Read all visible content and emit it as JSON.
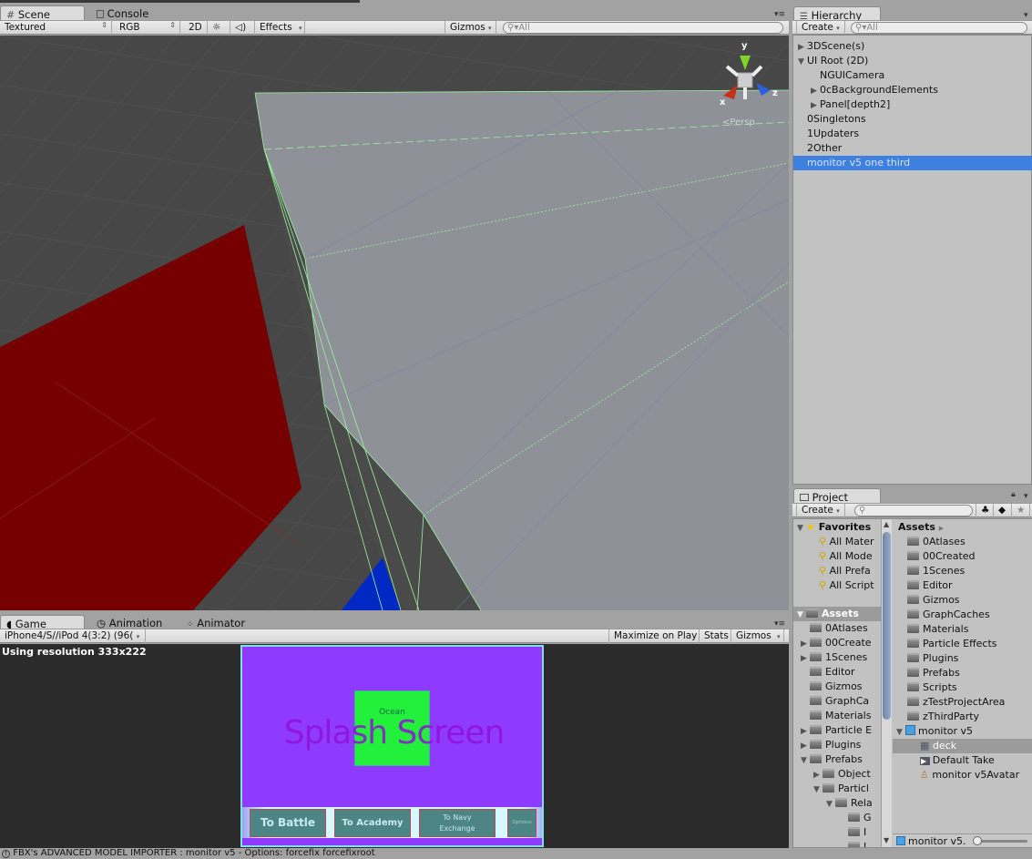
{
  "scene_panel": {
    "tabs": [
      {
        "label": "Scene",
        "icon": "grid-icon",
        "active": true
      },
      {
        "label": "Console",
        "icon": "console-icon",
        "active": false
      }
    ],
    "toolbar": {
      "shading_mode": "Textured",
      "render_mode": "RGB",
      "mode_2d": "2D",
      "lighting_icon": "sun-icon",
      "audio_icon": "speaker-icon",
      "effects": "Effects",
      "gizmos": "Gizmos",
      "search_placeholder": "All"
    },
    "orientation_gizmo": {
      "y": "y",
      "x": "x",
      "z": "z",
      "projection": "Persp"
    },
    "colors": {
      "background": "#474747",
      "plane": "#8e9198",
      "red_object": "#760000",
      "blue_object": "#0029c3",
      "wireframe": "#9cf59c"
    }
  },
  "hierarchy_panel": {
    "tab_label": "Hierarchy",
    "create_label": "Create",
    "search_placeholder": "All",
    "items": [
      {
        "label": "3DScene(s)",
        "depth": 0,
        "expander": "collapsed",
        "selected": false
      },
      {
        "label": "UI Root (2D)",
        "depth": 0,
        "expander": "expanded",
        "selected": false
      },
      {
        "label": "NGUICamera",
        "depth": 1,
        "expander": "none",
        "selected": false
      },
      {
        "label": "0cBackgroundElements",
        "depth": 1,
        "expander": "collapsed",
        "selected": false
      },
      {
        "label": "Panel[depth2]",
        "depth": 1,
        "expander": "collapsed",
        "selected": false
      },
      {
        "label": "0Singletons",
        "depth": 0,
        "expander": "none",
        "selected": false
      },
      {
        "label": "1Updaters",
        "depth": 0,
        "expander": "none",
        "selected": false
      },
      {
        "label": "2Other",
        "depth": 0,
        "expander": "none",
        "selected": false
      },
      {
        "label": "monitor v5 one third",
        "depth": 0,
        "expander": "none",
        "selected": true
      }
    ]
  },
  "project_panel": {
    "tab_label": "Project",
    "create_label": "Create",
    "search_placeholder": "",
    "favorites_label": "Favorites",
    "favorites": [
      "All Mater",
      "All Mode",
      "All Prefa",
      "All Script"
    ],
    "assets_label": "Assets",
    "tree": [
      {
        "label": "0Atlases",
        "depth": 1,
        "expander": "none"
      },
      {
        "label": "00Create",
        "depth": 1,
        "expander": "collapsed"
      },
      {
        "label": "1Scenes",
        "depth": 1,
        "expander": "collapsed"
      },
      {
        "label": "Editor",
        "depth": 1,
        "expander": "none"
      },
      {
        "label": "Gizmos",
        "depth": 1,
        "expander": "none"
      },
      {
        "label": "GraphCa",
        "depth": 1,
        "expander": "none"
      },
      {
        "label": "Materials",
        "depth": 1,
        "expander": "none"
      },
      {
        "label": "Particle E",
        "depth": 1,
        "expander": "collapsed"
      },
      {
        "label": "Plugins",
        "depth": 1,
        "expander": "collapsed"
      },
      {
        "label": "Prefabs",
        "depth": 1,
        "expander": "expanded"
      },
      {
        "label": "Object",
        "depth": 2,
        "expander": "collapsed"
      },
      {
        "label": "Particl",
        "depth": 2,
        "expander": "expanded"
      },
      {
        "label": "Rela",
        "depth": 3,
        "expander": "expanded"
      },
      {
        "label": "G",
        "depth": 4,
        "expander": "none"
      },
      {
        "label": "I",
        "depth": 4,
        "expander": "none"
      },
      {
        "label": "I",
        "depth": 4,
        "expander": "none"
      }
    ],
    "breadcrumb": "Assets",
    "contents": [
      {
        "label": "0Atlases",
        "type": "folder"
      },
      {
        "label": "00Created",
        "type": "folder"
      },
      {
        "label": "1Scenes",
        "type": "folder"
      },
      {
        "label": "Editor",
        "type": "folder"
      },
      {
        "label": "Gizmos",
        "type": "folder"
      },
      {
        "label": "GraphCaches",
        "type": "folder"
      },
      {
        "label": "Materials",
        "type": "folder"
      },
      {
        "label": "Particle Effects",
        "type": "folder"
      },
      {
        "label": "Plugins",
        "type": "folder"
      },
      {
        "label": "Prefabs",
        "type": "folder"
      },
      {
        "label": "Scripts",
        "type": "folder"
      },
      {
        "label": "zTestProjectArea",
        "type": "folder"
      },
      {
        "label": "zThirdParty",
        "type": "folder"
      },
      {
        "label": "monitor v5",
        "type": "model",
        "expanded": true
      },
      {
        "label": "deck",
        "type": "mesh",
        "selected": true
      },
      {
        "label": "Default Take",
        "type": "animation"
      },
      {
        "label": "monitor v5Avatar",
        "type": "avatar"
      }
    ],
    "footer_label": "monitor v5.",
    "zoom_slider": 0.0
  },
  "game_panel": {
    "tabs": [
      {
        "label": "Game",
        "icon": "pacman-icon",
        "active": true
      },
      {
        "label": "Animation",
        "icon": "clock-icon",
        "active": false
      },
      {
        "label": "Animator",
        "icon": "animator-icon",
        "active": false
      }
    ],
    "resolution_dropdown": "iPhone4/S//iPod 4(3:2) (96(",
    "maximize_on_play": "Maximize on Play",
    "stats": "Stats",
    "gizmos": "Gizmos",
    "resolution_info": "Using resolution 333x222",
    "viewport": {
      "title": "Splash Screen",
      "green_box_label": "Ocean",
      "buttons": [
        "To Battle",
        "To Academy",
        "To Navy Exchange",
        "Options"
      ],
      "colors": {
        "background": "#8f3bff",
        "title": "#9010d8",
        "green_box": "#22f03a",
        "button": "#4d8585",
        "button_border": "#b84a5a"
      }
    }
  },
  "status_bar": {
    "icon": "info-icon",
    "message": "FBX's ADVANCED MODEL IMPORTER : monitor v5 - Options: forcefix forcefixroot"
  }
}
